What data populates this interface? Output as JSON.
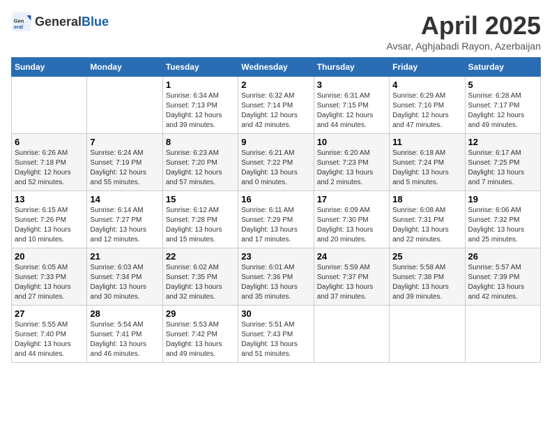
{
  "header": {
    "logo_general": "General",
    "logo_blue": "Blue",
    "title": "April 2025",
    "subtitle": "Avsar, Aghjabadi Rayon, Azerbaijan"
  },
  "weekdays": [
    "Sunday",
    "Monday",
    "Tuesday",
    "Wednesday",
    "Thursday",
    "Friday",
    "Saturday"
  ],
  "weeks": [
    [
      {
        "day": "",
        "sunrise": "",
        "sunset": "",
        "daylight": ""
      },
      {
        "day": "",
        "sunrise": "",
        "sunset": "",
        "daylight": ""
      },
      {
        "day": "1",
        "sunrise": "Sunrise: 6:34 AM",
        "sunset": "Sunset: 7:13 PM",
        "daylight": "Daylight: 12 hours and 39 minutes."
      },
      {
        "day": "2",
        "sunrise": "Sunrise: 6:32 AM",
        "sunset": "Sunset: 7:14 PM",
        "daylight": "Daylight: 12 hours and 42 minutes."
      },
      {
        "day": "3",
        "sunrise": "Sunrise: 6:31 AM",
        "sunset": "Sunset: 7:15 PM",
        "daylight": "Daylight: 12 hours and 44 minutes."
      },
      {
        "day": "4",
        "sunrise": "Sunrise: 6:29 AM",
        "sunset": "Sunset: 7:16 PM",
        "daylight": "Daylight: 12 hours and 47 minutes."
      },
      {
        "day": "5",
        "sunrise": "Sunrise: 6:28 AM",
        "sunset": "Sunset: 7:17 PM",
        "daylight": "Daylight: 12 hours and 49 minutes."
      }
    ],
    [
      {
        "day": "6",
        "sunrise": "Sunrise: 6:26 AM",
        "sunset": "Sunset: 7:18 PM",
        "daylight": "Daylight: 12 hours and 52 minutes."
      },
      {
        "day": "7",
        "sunrise": "Sunrise: 6:24 AM",
        "sunset": "Sunset: 7:19 PM",
        "daylight": "Daylight: 12 hours and 55 minutes."
      },
      {
        "day": "8",
        "sunrise": "Sunrise: 6:23 AM",
        "sunset": "Sunset: 7:20 PM",
        "daylight": "Daylight: 12 hours and 57 minutes."
      },
      {
        "day": "9",
        "sunrise": "Sunrise: 6:21 AM",
        "sunset": "Sunset: 7:22 PM",
        "daylight": "Daylight: 13 hours and 0 minutes."
      },
      {
        "day": "10",
        "sunrise": "Sunrise: 6:20 AM",
        "sunset": "Sunset: 7:23 PM",
        "daylight": "Daylight: 13 hours and 2 minutes."
      },
      {
        "day": "11",
        "sunrise": "Sunrise: 6:18 AM",
        "sunset": "Sunset: 7:24 PM",
        "daylight": "Daylight: 13 hours and 5 minutes."
      },
      {
        "day": "12",
        "sunrise": "Sunrise: 6:17 AM",
        "sunset": "Sunset: 7:25 PM",
        "daylight": "Daylight: 13 hours and 7 minutes."
      }
    ],
    [
      {
        "day": "13",
        "sunrise": "Sunrise: 6:15 AM",
        "sunset": "Sunset: 7:26 PM",
        "daylight": "Daylight: 13 hours and 10 minutes."
      },
      {
        "day": "14",
        "sunrise": "Sunrise: 6:14 AM",
        "sunset": "Sunset: 7:27 PM",
        "daylight": "Daylight: 13 hours and 12 minutes."
      },
      {
        "day": "15",
        "sunrise": "Sunrise: 6:12 AM",
        "sunset": "Sunset: 7:28 PM",
        "daylight": "Daylight: 13 hours and 15 minutes."
      },
      {
        "day": "16",
        "sunrise": "Sunrise: 6:11 AM",
        "sunset": "Sunset: 7:29 PM",
        "daylight": "Daylight: 13 hours and 17 minutes."
      },
      {
        "day": "17",
        "sunrise": "Sunrise: 6:09 AM",
        "sunset": "Sunset: 7:30 PM",
        "daylight": "Daylight: 13 hours and 20 minutes."
      },
      {
        "day": "18",
        "sunrise": "Sunrise: 6:08 AM",
        "sunset": "Sunset: 7:31 PM",
        "daylight": "Daylight: 13 hours and 22 minutes."
      },
      {
        "day": "19",
        "sunrise": "Sunrise: 6:06 AM",
        "sunset": "Sunset: 7:32 PM",
        "daylight": "Daylight: 13 hours and 25 minutes."
      }
    ],
    [
      {
        "day": "20",
        "sunrise": "Sunrise: 6:05 AM",
        "sunset": "Sunset: 7:33 PM",
        "daylight": "Daylight: 13 hours and 27 minutes."
      },
      {
        "day": "21",
        "sunrise": "Sunrise: 6:03 AM",
        "sunset": "Sunset: 7:34 PM",
        "daylight": "Daylight: 13 hours and 30 minutes."
      },
      {
        "day": "22",
        "sunrise": "Sunrise: 6:02 AM",
        "sunset": "Sunset: 7:35 PM",
        "daylight": "Daylight: 13 hours and 32 minutes."
      },
      {
        "day": "23",
        "sunrise": "Sunrise: 6:01 AM",
        "sunset": "Sunset: 7:36 PM",
        "daylight": "Daylight: 13 hours and 35 minutes."
      },
      {
        "day": "24",
        "sunrise": "Sunrise: 5:59 AM",
        "sunset": "Sunset: 7:37 PM",
        "daylight": "Daylight: 13 hours and 37 minutes."
      },
      {
        "day": "25",
        "sunrise": "Sunrise: 5:58 AM",
        "sunset": "Sunset: 7:38 PM",
        "daylight": "Daylight: 13 hours and 39 minutes."
      },
      {
        "day": "26",
        "sunrise": "Sunrise: 5:57 AM",
        "sunset": "Sunset: 7:39 PM",
        "daylight": "Daylight: 13 hours and 42 minutes."
      }
    ],
    [
      {
        "day": "27",
        "sunrise": "Sunrise: 5:55 AM",
        "sunset": "Sunset: 7:40 PM",
        "daylight": "Daylight: 13 hours and 44 minutes."
      },
      {
        "day": "28",
        "sunrise": "Sunrise: 5:54 AM",
        "sunset": "Sunset: 7:41 PM",
        "daylight": "Daylight: 13 hours and 46 minutes."
      },
      {
        "day": "29",
        "sunrise": "Sunrise: 5:53 AM",
        "sunset": "Sunset: 7:42 PM",
        "daylight": "Daylight: 13 hours and 49 minutes."
      },
      {
        "day": "30",
        "sunrise": "Sunrise: 5:51 AM",
        "sunset": "Sunset: 7:43 PM",
        "daylight": "Daylight: 13 hours and 51 minutes."
      },
      {
        "day": "",
        "sunrise": "",
        "sunset": "",
        "daylight": ""
      },
      {
        "day": "",
        "sunrise": "",
        "sunset": "",
        "daylight": ""
      },
      {
        "day": "",
        "sunrise": "",
        "sunset": "",
        "daylight": ""
      }
    ]
  ]
}
